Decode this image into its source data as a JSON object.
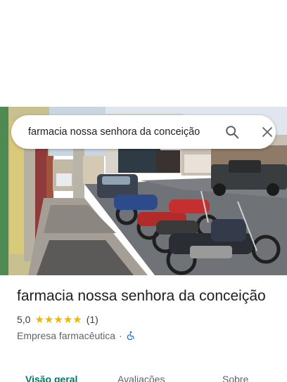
{
  "search": {
    "query": "farmacia nossa senhora da conceição"
  },
  "place": {
    "title": "farmacia nossa senhora da conceição",
    "rating": "5,0",
    "stars": 5,
    "review_count": "(1)",
    "category": "Empresa farmacêutica",
    "separator": "·"
  },
  "tabs": [
    {
      "label": "Visão geral",
      "active": true
    },
    {
      "label": "Avaliações",
      "active": false
    },
    {
      "label": "Sobre",
      "active": false
    }
  ],
  "colors": {
    "accent": "#00796b",
    "star": "#f4b400",
    "accessibility": "#1a73e8"
  },
  "icons": {
    "search": "search-icon",
    "close": "close-icon",
    "accessibility": "wheelchair-icon"
  }
}
